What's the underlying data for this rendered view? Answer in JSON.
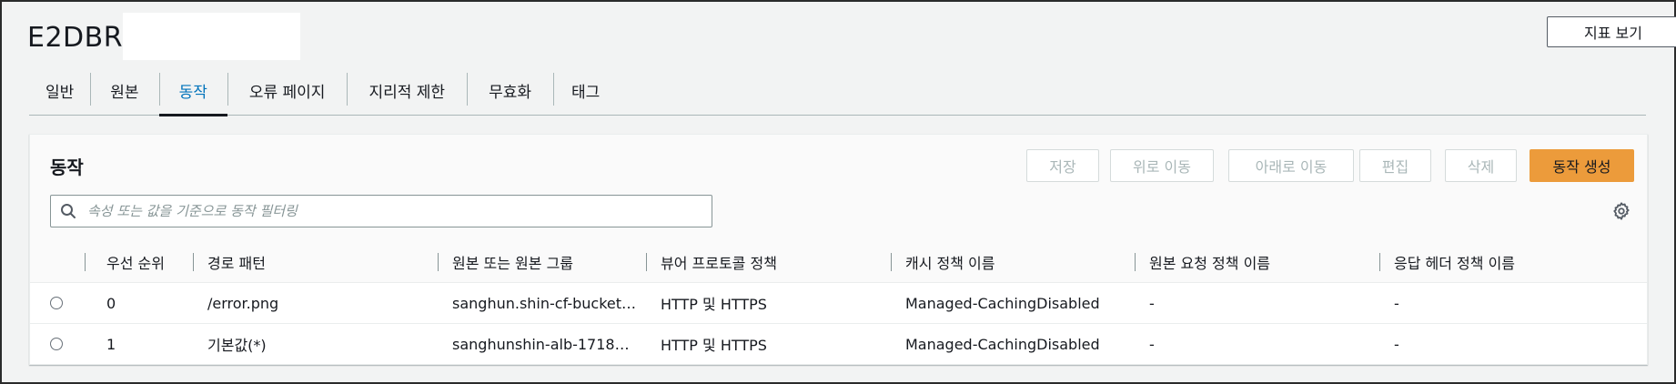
{
  "header": {
    "title": "E2DBR",
    "metrics_button": "지표 보기"
  },
  "tabs": [
    {
      "label": "일반"
    },
    {
      "label": "원본"
    },
    {
      "label": "동작",
      "active": true
    },
    {
      "label": "오류 페이지"
    },
    {
      "label": "지리적 제한"
    },
    {
      "label": "무효화"
    },
    {
      "label": "태그"
    }
  ],
  "panel": {
    "title": "동작",
    "buttons": {
      "save": "저장",
      "move_up": "위로 이동",
      "move_down": "아래로 이동",
      "edit": "편집",
      "delete": "삭제",
      "create": "동작 생성"
    },
    "search_placeholder": "속성 또는 값을 기준으로 동작 필터링"
  },
  "table": {
    "columns": [
      "우선 순위",
      "경로 패턴",
      "원본 또는 원본 그룹",
      "뷰어 프로토콜 정책",
      "캐시 정책 이름",
      "원본 요청 정책 이름",
      "응답 헤더 정책 이름"
    ],
    "rows": [
      {
        "priority": "0",
        "path": "/error.png",
        "origin": "sanghun.shin-cf-bucket…",
        "viewer": "HTTP 및 HTTPS",
        "cache": "Managed-CachingDisabled",
        "origin_request": "-",
        "response_headers": "-"
      },
      {
        "priority": "1",
        "path": "기본값(*)",
        "origin": "sanghunshin-alb-1718…",
        "viewer": "HTTP 및 HTTPS",
        "cache": "Managed-CachingDisabled",
        "origin_request": "-",
        "response_headers": "-"
      }
    ]
  },
  "colors": {
    "accent": "#0073bb",
    "primary_button": "#ec9b3b",
    "disabled_text": "#aab7b8"
  }
}
